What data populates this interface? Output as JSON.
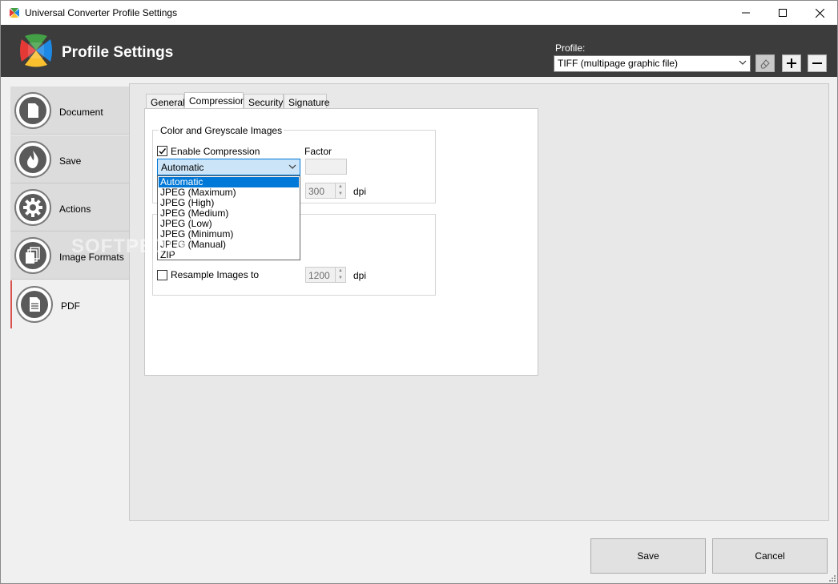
{
  "window": {
    "title": "Universal Converter Profile Settings"
  },
  "header": {
    "title": "Profile Settings",
    "profile_label": "Profile:",
    "profile_value": "TIFF (multipage graphic file)"
  },
  "sidebar": {
    "items": [
      {
        "label": "Document",
        "icon": "document-icon"
      },
      {
        "label": "Save",
        "icon": "flame-icon"
      },
      {
        "label": "Actions",
        "icon": "gear-icon"
      },
      {
        "label": "Image Formats",
        "icon": "stacked-pages-icon"
      },
      {
        "label": "PDF",
        "icon": "pdf-document-icon",
        "active": true
      }
    ]
  },
  "tabs": [
    {
      "label": "General"
    },
    {
      "label": "Compression",
      "active": true
    },
    {
      "label": "Security"
    },
    {
      "label": "Signature"
    }
  ],
  "compression": {
    "group_title": "Color and Greyscale Images",
    "enable_compression_label": "Enable Compression",
    "enable_compression_checked": true,
    "factor_label": "Factor",
    "compression_value": "Automatic",
    "dpi_value": "300",
    "dpi_unit": "dpi",
    "dropdown_options": [
      "Automatic",
      "JPEG (Maximum)",
      "JPEG (High)",
      "JPEG (Medium)",
      "JPEG (Low)",
      "JPEG (Minimum)",
      "JPEG (Manual)",
      "ZIP"
    ],
    "resample_label": "Resample Images to",
    "resample_checked": false,
    "resample_value": "1200",
    "resample_unit": "dpi"
  },
  "watermark": "SOFTPEDIA",
  "footer": {
    "save_label": "Save",
    "cancel_label": "Cancel"
  },
  "colors": {
    "header_bg": "#3c3c3c",
    "accent": "#0078d7",
    "active_marker": "#d9534f"
  }
}
